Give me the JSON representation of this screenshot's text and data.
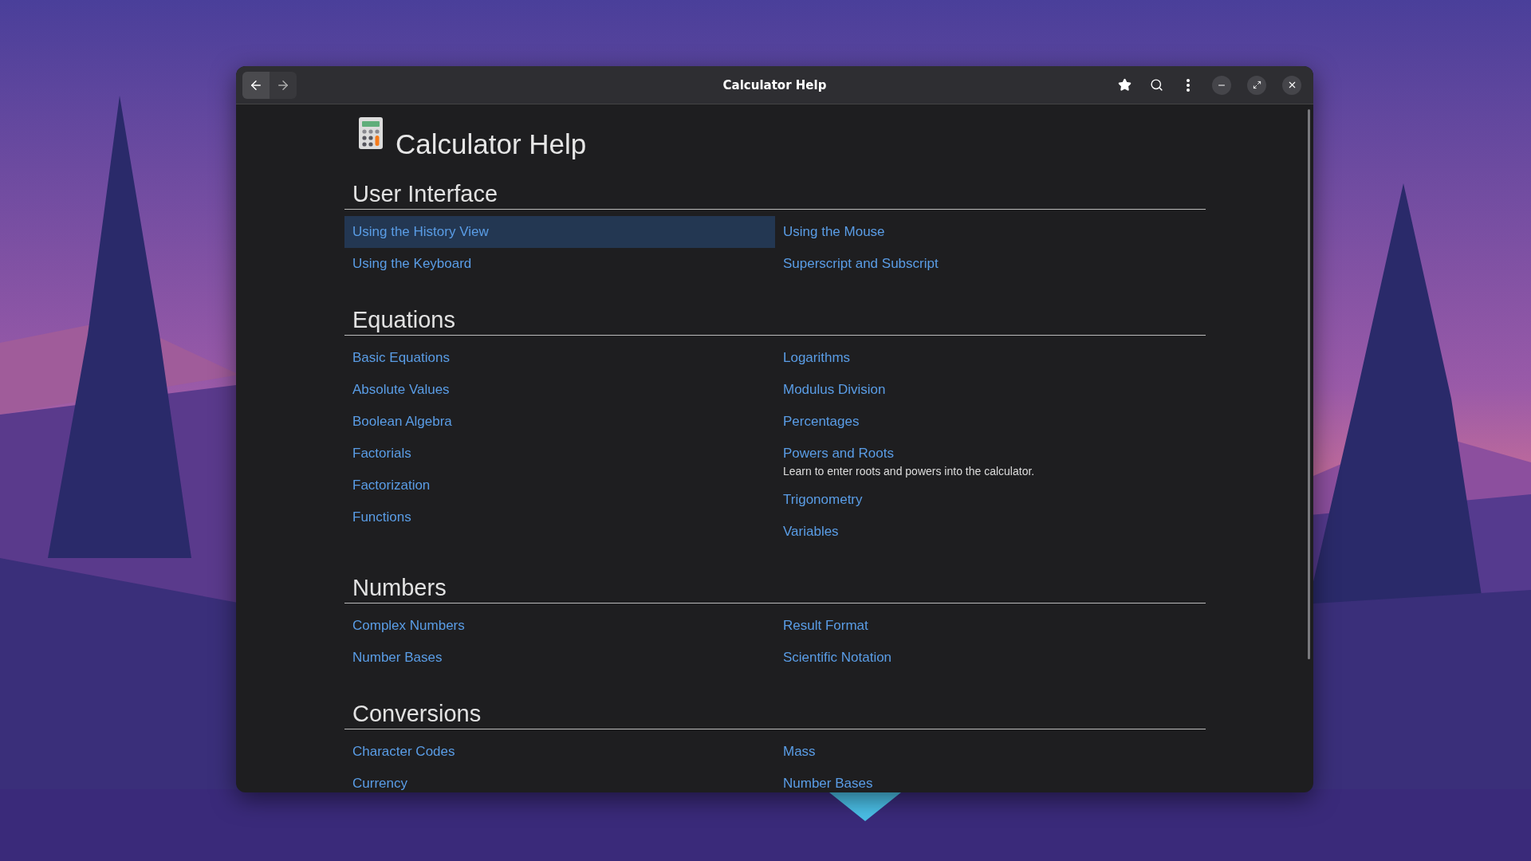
{
  "window": {
    "title": "Calculator Help"
  },
  "page": {
    "title": "Calculator Help"
  },
  "sections": [
    {
      "title": "User Interface",
      "columns": [
        [
          {
            "label": "Using the History View",
            "selected": true
          },
          {
            "label": "Using the Keyboard",
            "selected": false
          }
        ],
        [
          {
            "label": "Using the Mouse",
            "selected": false
          },
          {
            "label": "Superscript and Subscript",
            "selected": false
          }
        ]
      ]
    },
    {
      "title": "Equations",
      "columns": [
        [
          {
            "label": "Basic Equations",
            "selected": false
          },
          {
            "label": "Absolute Values",
            "selected": false
          },
          {
            "label": "Boolean Algebra",
            "selected": false
          },
          {
            "label": "Factorials",
            "selected": false
          },
          {
            "label": "Factorization",
            "selected": false
          },
          {
            "label": "Functions",
            "selected": false
          }
        ],
        [
          {
            "label": "Logarithms",
            "selected": false
          },
          {
            "label": "Modulus Division",
            "selected": false
          },
          {
            "label": "Percentages",
            "selected": false
          },
          {
            "label": "Powers and Roots",
            "selected": false,
            "description": "Learn to enter roots and powers into the calculator."
          },
          {
            "label": "Trigonometry",
            "selected": false
          },
          {
            "label": "Variables",
            "selected": false
          }
        ]
      ]
    },
    {
      "title": "Numbers",
      "columns": [
        [
          {
            "label": "Complex Numbers",
            "selected": false
          },
          {
            "label": "Number Bases",
            "selected": false
          }
        ],
        [
          {
            "label": "Result Format",
            "selected": false
          },
          {
            "label": "Scientific Notation",
            "selected": false
          }
        ]
      ]
    },
    {
      "title": "Conversions",
      "columns": [
        [
          {
            "label": "Character Codes",
            "selected": false
          },
          {
            "label": "Currency",
            "selected": false
          }
        ],
        [
          {
            "label": "Mass",
            "selected": false
          },
          {
            "label": "Number Bases",
            "selected": false
          }
        ]
      ]
    }
  ]
}
